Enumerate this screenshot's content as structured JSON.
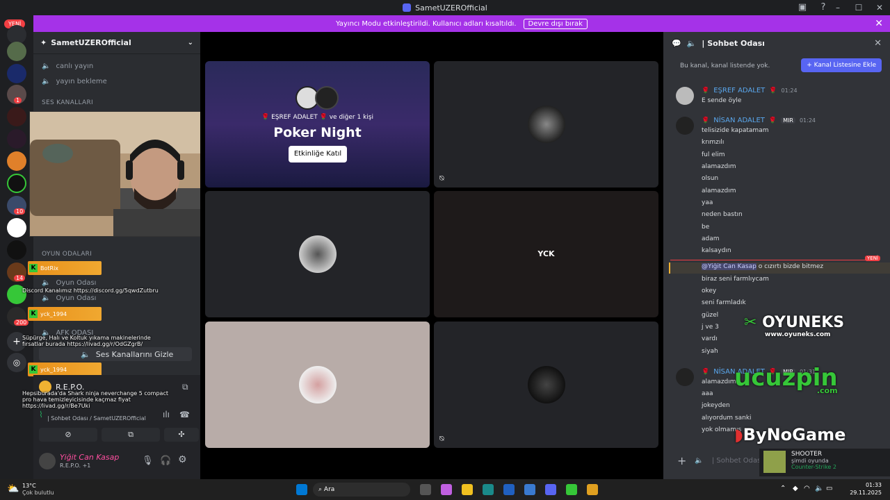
{
  "window": {
    "title": "SametUZEROfficial",
    "controls": [
      "–",
      "☐",
      "✕"
    ]
  },
  "banner": {
    "text": "Yayıncı Modu etkinleştirildi. Kullanıcı adları kısaltıldı.",
    "button": "Devre dışı bırak"
  },
  "server_rail": {
    "new_label": "YENİ",
    "badges": [
      "1",
      "10",
      "14",
      "200"
    ]
  },
  "sidebar": {
    "server_name": "SametUZEROfficial",
    "channels_top": [
      "canlı yayın",
      "yayın bekleme"
    ],
    "category_voice": "SES KANALLARI",
    "category_game": "OYUN ODALARI",
    "game_rooms": [
      "Oyun Odası",
      "Oyun Odası"
    ],
    "afk": "AFK ODASI",
    "hide_voice": "Ses Kanallarını Gizle"
  },
  "overlay": {
    "tags": [
      "BotRix",
      "yck_1994",
      "yck_1994"
    ],
    "messages": [
      "Discord Kanalımız https://discord.gg/5qwdZutbru",
      "Süpürge, Halı ve Koltuk yıkama makinelerinde fırsatlar burada https://livad.gg/r/OdGZgrB/",
      "Hepsiburada'da Shark ninja neverchange 5 compact pro hava temizleyicisinde kaçmaz fiyat https://livad.gg/r/Be7Uki"
    ]
  },
  "voice_panel": {
    "activity": "R.E.P.O.",
    "channel_info": "| Sohbet Odası / SametUZEROfficial"
  },
  "user_panel": {
    "username": "Yiğit Can Kasap",
    "status": "R.E.P.O. +1"
  },
  "stage": {
    "activity": {
      "host_line": "EŞREF ADALET",
      "others": "ve diğer 1 kişi",
      "title": "Poker Night",
      "join_button": "Etkinliğe Katıl"
    },
    "tile_label": "YCK"
  },
  "chat": {
    "channel": "| Sohbet Odası",
    "notice": "Bu kanal, kanal listende yok.",
    "add_button": "Kanal Listesine Ekle",
    "new_marker": "YENİ",
    "messages": [
      {
        "author": "EŞREF ADALET",
        "time": "01:24",
        "lines": [
          "E sende öyle"
        ]
      },
      {
        "author": "NİSAN ADALET",
        "tag": "MIR",
        "time": "01:24",
        "lines": [
          "telisizide kapatamam",
          "krımzılı",
          "ful elim",
          "alamazdım",
          "olsun",
          "alamazdım",
          "yaa",
          "neden bastın",
          "be",
          "adam",
          "kalsaydın"
        ]
      },
      {
        "mention": "@Yiğit Can Kasap",
        "lines": [
          "o cızırtı bizde bitmez",
          "biraz seni farmlıycam",
          "okey",
          "seni farmladık",
          "güzel",
          "j ve 3",
          "vardı",
          "siyah"
        ]
      },
      {
        "author": "NİSAN ADALET",
        "tag": "MIR",
        "time": "01:31",
        "lines": [
          "alamazdım",
          "aaa",
          "jokeyden",
          "alıyordum sanki",
          "yok olmamış"
        ]
      }
    ],
    "input_placeholder": "| Sohbet Odas"
  },
  "game_card": {
    "name": "SHOOTER",
    "status": "şimdi oyunda",
    "game": "Counter-Strike 2"
  },
  "watermarks": {
    "oyuneks": "OYUNEKS",
    "oyuneks_url": "www.oyuneks.com",
    "ucuzpin": "ucuzpin",
    "ucuzpin_tld": ".com",
    "bynogame": "ByNoGame"
  },
  "taskbar": {
    "weather_temp": "13°C",
    "weather_desc": "Çok bulutlu",
    "search": "Ara",
    "time": "01:33",
    "date": "29.11.2025"
  }
}
